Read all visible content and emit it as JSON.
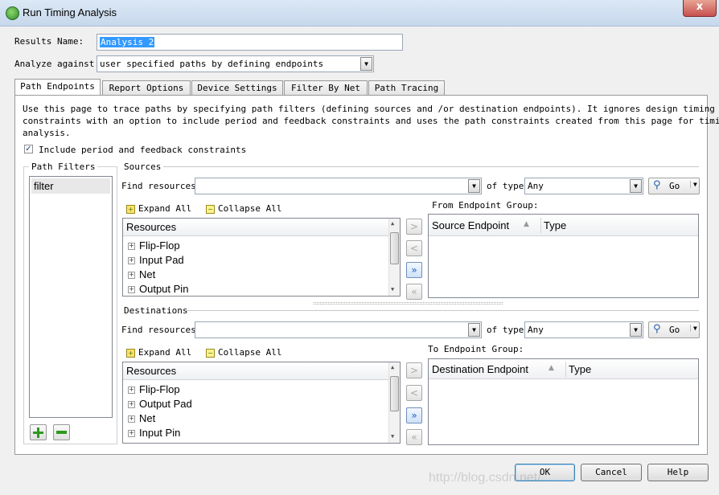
{
  "window": {
    "title": "Run Timing Analysis",
    "close_label": "x",
    "app_icon": "timing-analyzer-icon"
  },
  "results_name": {
    "label": "Results Name:",
    "value": "Analysis 2"
  },
  "analyze_against": {
    "label": "Analyze against:",
    "value": "user specified paths by defining endpoints"
  },
  "tabs": [
    {
      "label": "Path Endpoints",
      "active": true
    },
    {
      "label": "Report Options",
      "active": false
    },
    {
      "label": "Device Settings",
      "active": false
    },
    {
      "label": "Filter By Net",
      "active": false
    },
    {
      "label": "Path Tracing",
      "active": false
    }
  ],
  "description": {
    "line1": "Use this page to trace paths by specifying path filters (defining sources and /or destination endpoints).  It ignores design timing",
    "line2": "constraints with an option to include period and feedback constraints and uses the path constraints created from this page  for timing",
    "line3": "analysis."
  },
  "include_constraints": {
    "label": "Include period and feedback constraints",
    "checked": true
  },
  "path_filters": {
    "title": "Path Filters",
    "items": [
      "filter"
    ]
  },
  "sources": {
    "title": "Sources",
    "find_label": "Find resources",
    "find_value": "",
    "of_type_label": "of type",
    "type_value": "Any",
    "go_label": "Go",
    "expand_all": "Expand All",
    "collapse_all": "Collapse All",
    "resources_header": "Resources",
    "resources": [
      "Flip-Flop",
      "Input Pad",
      "Net",
      "Output Pin"
    ],
    "group_label": "From Endpoint Group:",
    "group_cols": [
      "Source Endpoint",
      "Type"
    ]
  },
  "destinations": {
    "title": "Destinations",
    "find_label": "Find resources",
    "find_value": "",
    "of_type_label": "of type",
    "type_value": "Any",
    "go_label": "Go",
    "expand_all": "Expand All",
    "collapse_all": "Collapse All",
    "resources_header": "Resources",
    "resources": [
      "Flip-Flop",
      "Output Pad",
      "Net",
      "Input Pin"
    ],
    "group_label": "To Endpoint Group:",
    "group_cols": [
      "Destination Endpoint",
      "Type"
    ]
  },
  "buttons": {
    "ok": "OK",
    "cancel": "Cancel",
    "help": "Help"
  },
  "watermark": "http://blog.csdn.net/..."
}
